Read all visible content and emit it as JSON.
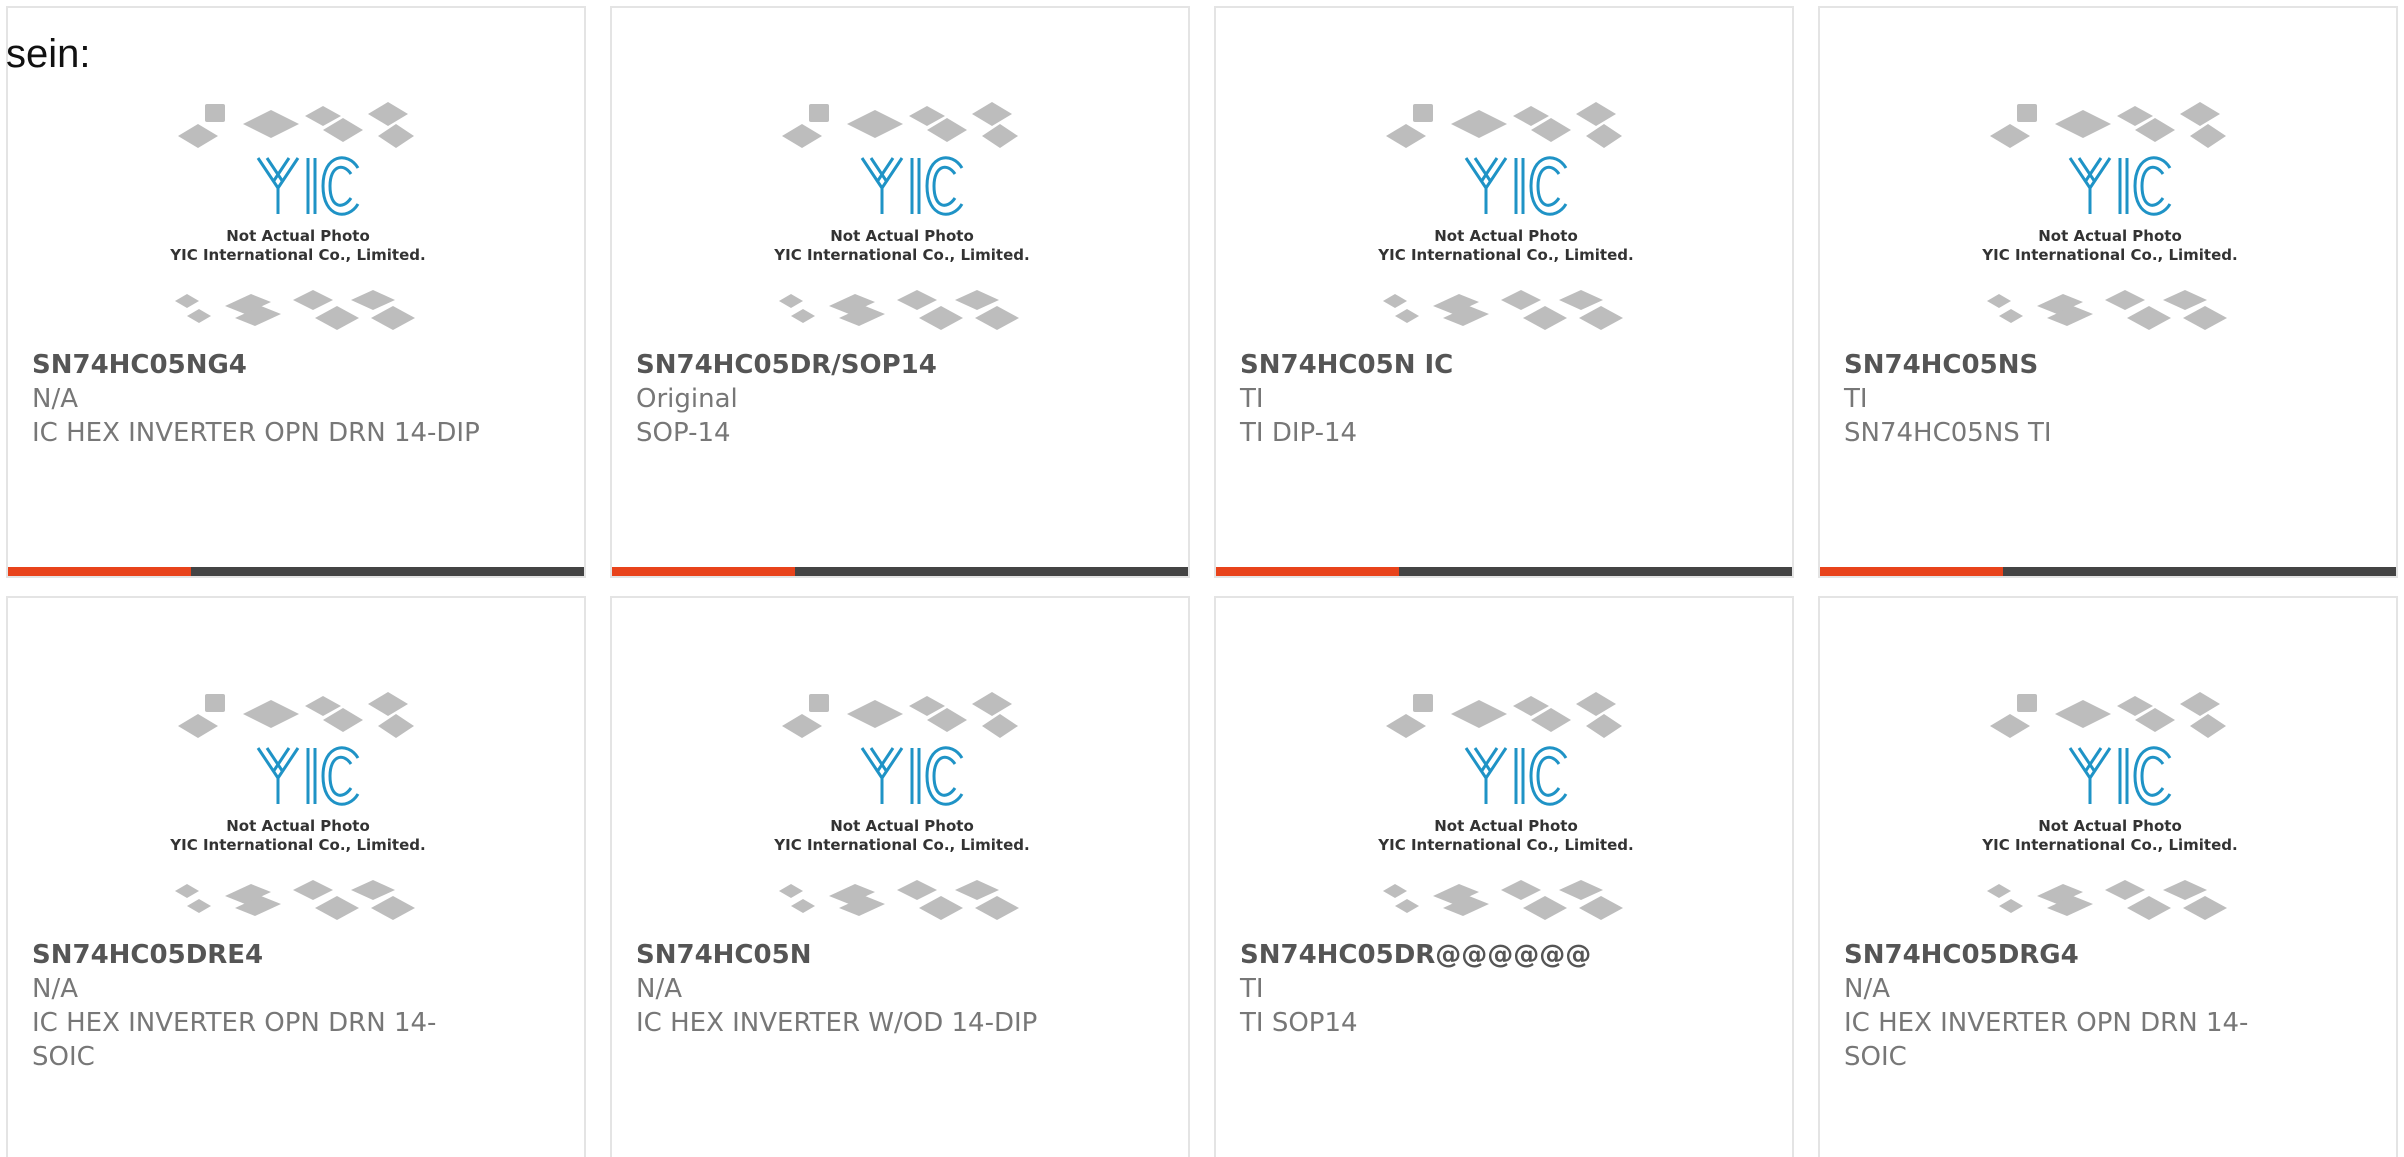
{
  "intro_text": "sein:",
  "placeholder": {
    "line1": "Not Actual Photo",
    "line2": "YIC International Co., Limited.",
    "logo_letters": "YIC"
  },
  "products": [
    {
      "part": "SN74HC05NG4",
      "brand": "N/A",
      "desc": "IC HEX INVERTER OPN DRN 14-DIP"
    },
    {
      "part": "SN74HC05DR/SOP14",
      "brand": "Original",
      "desc": "SOP-14"
    },
    {
      "part": "SN74HC05N IC",
      "brand": "TI",
      "desc": "TI DIP-14"
    },
    {
      "part": "SN74HC05NS",
      "brand": "TI",
      "desc": "SN74HC05NS TI"
    },
    {
      "part": "SN74HC05DRE4",
      "brand": "N/A",
      "desc": "IC HEX INVERTER OPN DRN 14-SOIC"
    },
    {
      "part": "SN74HC05N",
      "brand": "N/A",
      "desc": "IC HEX INVERTER W/OD 14-DIP"
    },
    {
      "part": "SN74HC05DR@@@@@@",
      "brand": "TI",
      "desc": "TI SOP14"
    },
    {
      "part": "SN74HC05DRG4",
      "brand": "N/A",
      "desc": "IC HEX INVERTER OPN DRN 14-SOIC"
    }
  ],
  "colors": {
    "accent": "#e8431b",
    "bar": "#444444",
    "logo_blue": "#1f93c6"
  }
}
